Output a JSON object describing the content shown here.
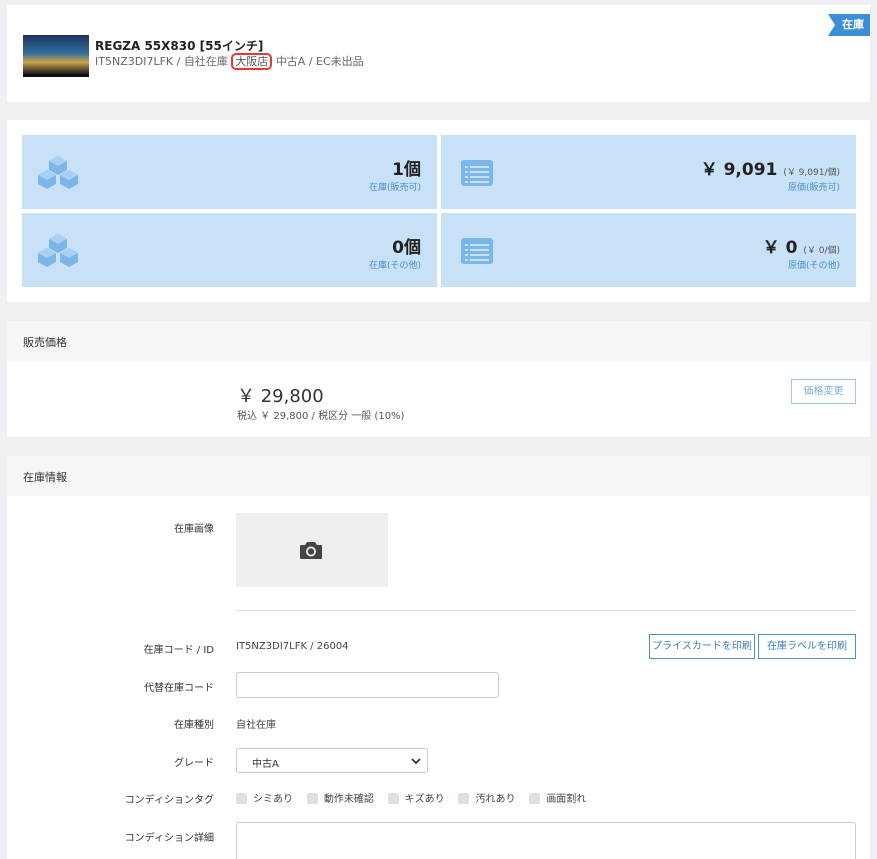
{
  "product": {
    "title": "REGZA 55X830 [55インチ]",
    "code": "IT5NZ3DI7LFK",
    "stock_type": "自社在庫",
    "store": "大阪店",
    "grade": "中古A",
    "ec_status": "EC未出品",
    "separator": " / ",
    "badge": "在庫"
  },
  "stats": [
    {
      "icon": "boxes-icon",
      "value": "1個",
      "sub": "",
      "label": "在庫(販売可)"
    },
    {
      "icon": "list-icon",
      "value": "￥ 9,091",
      "sub": "(￥ 9,091/個)",
      "label": "原価(販売可)"
    },
    {
      "icon": "boxes-icon",
      "value": "0個",
      "sub": "",
      "label": "在庫(その他)"
    },
    {
      "icon": "list-icon",
      "value": "￥ 0",
      "sub": "(￥ 0/個)",
      "label": "原価(その他)"
    }
  ],
  "price_section": {
    "title": "販売価格",
    "price": "￥ 29,800",
    "tax_note": "税込 ￥ 29,800 / 税区分 一般 (10%)",
    "change_button": "価格変更"
  },
  "stock_info": {
    "title": "在庫情報",
    "image_label": "在庫画像",
    "code_label": "在庫コード / ID",
    "code_value": "IT5NZ3DI7LFK / 26004",
    "print_price_card": "プライスカードを印刷",
    "print_stock_label": "在庫ラベルを印刷",
    "alt_code_label": "代替在庫コード",
    "alt_code_value": "",
    "type_label": "在庫種別",
    "type_value": "自社在庫",
    "grade_label": "グレード",
    "grade_value": "中古A",
    "condition_tag_label": "コンディションタグ",
    "condition_tags": [
      "シミあり",
      "動作未確認",
      "キズあり",
      "汚れあり",
      "画面割れ"
    ],
    "condition_detail_label": "コンディション詳細",
    "condition_detail_value": ""
  },
  "colors": {
    "accent": "#3b8fd9",
    "tile_bg": "#c8e1f6",
    "tile_icon": "#7ab6ea",
    "highlight": "#e53935"
  }
}
